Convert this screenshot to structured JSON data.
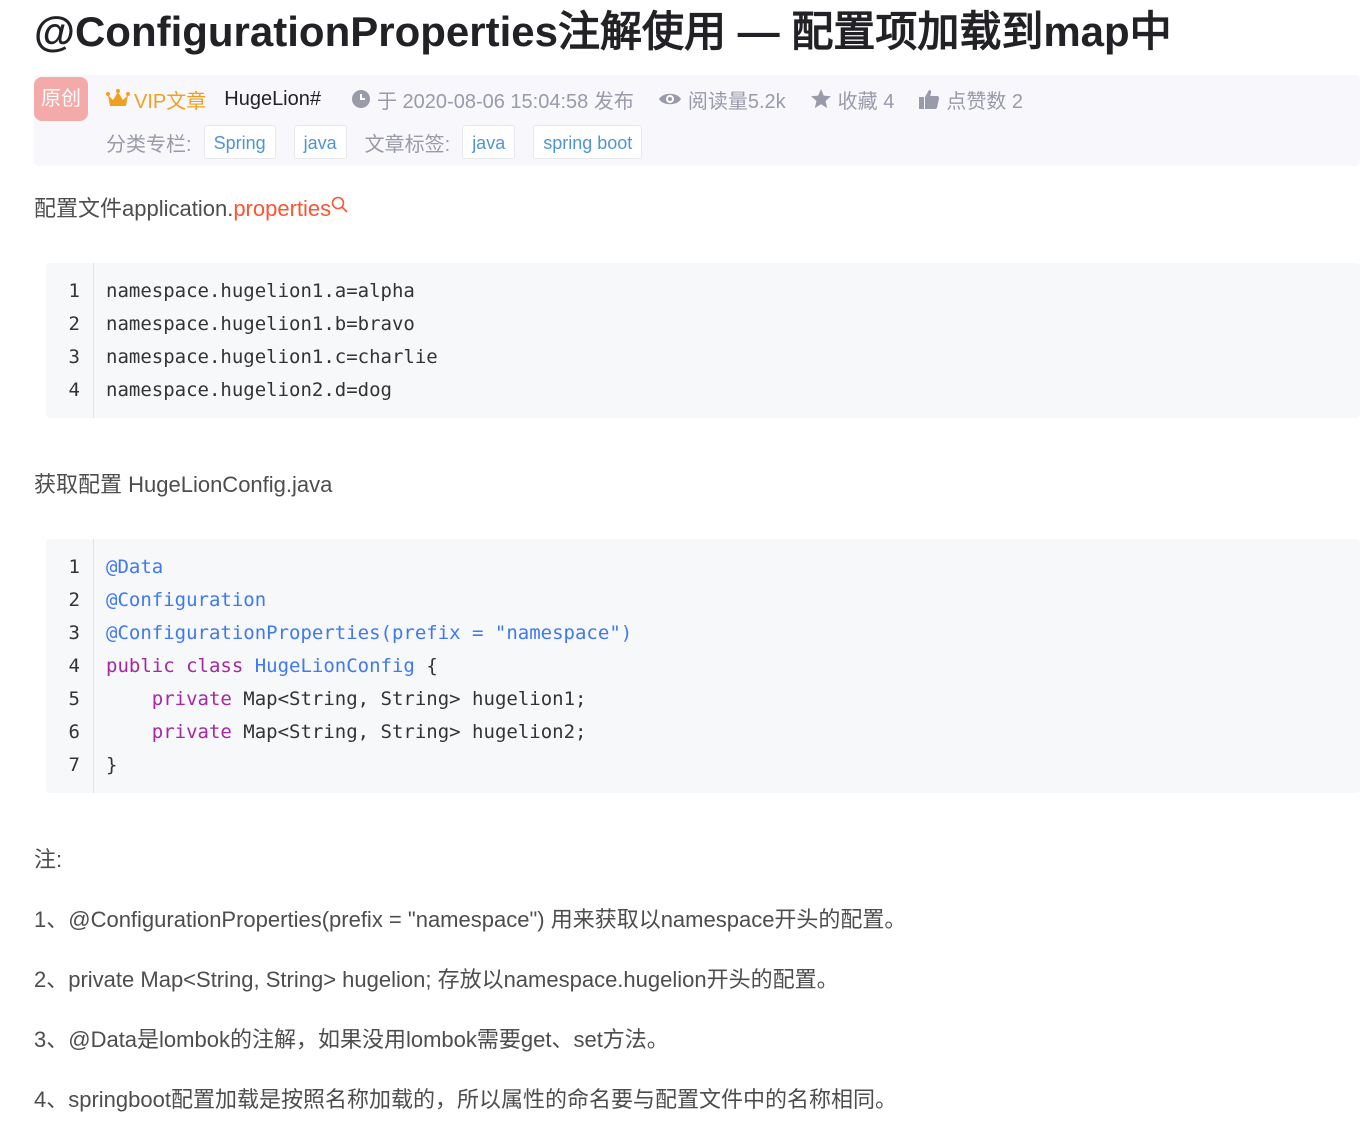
{
  "title": "@ConfigurationProperties注解使用 — 配置项加载到map中",
  "meta": {
    "badge": "原创",
    "vip_label": "VIP文章",
    "author": "HugeLion#",
    "published": "于 2020-08-06 15:04:58 发布",
    "reads": "阅读量5.2k",
    "favorites": "收藏 4",
    "likes": "点赞数 2",
    "category_label": "分类专栏:",
    "categories": [
      "Spring",
      "java"
    ],
    "tag_label": "文章标签:",
    "tags": [
      "java",
      "spring boot"
    ]
  },
  "p1": {
    "text": "配置文件application.",
    "link": "properties"
  },
  "code1": {
    "line_numbers": [
      "1",
      "2",
      "3",
      "4"
    ],
    "lines": [
      "namespace.hugelion1.a=alpha",
      "namespace.hugelion1.b=bravo",
      "namespace.hugelion1.c=charlie",
      "namespace.hugelion2.d=dog"
    ]
  },
  "p2": "获取配置 HugeLionConfig.java",
  "code2": {
    "line_numbers": [
      "1",
      "2",
      "3",
      "4",
      "5",
      "6",
      "7"
    ],
    "l1": "@Data",
    "l2": "@Configuration",
    "l3": "@ConfigurationProperties(prefix = \"namespace\")",
    "l4_kw": "public class ",
    "l4_cls": "HugeLionConfig",
    "l4_rest": " {",
    "l5_indent": "    ",
    "l5_kw": "private",
    "l5_rest": " Map<String, String> hugelion1;",
    "l6_indent": "    ",
    "l6_kw": "private",
    "l6_rest": " Map<String, String> hugelion2;",
    "l7": "}"
  },
  "notes": {
    "heading": "注:",
    "items": [
      "1、@ConfigurationProperties(prefix = \"namespace\") 用来获取以namespace开头的配置。",
      "2、private Map<String, String> hugelion; 存放以namespace.hugelion开头的配置。",
      "3、@Data是lombok的注解，如果没用lombok需要get、set方法。",
      "4、springboot配置加载是按照名称加载的，所以属性的命名要与配置文件中的名称相同。"
    ]
  },
  "colors": {
    "link": "#fc5531",
    "tag_text": "#5094d5",
    "vip": "#f0a020",
    "badge_bg": "#f3aaa9"
  },
  "icons": [
    "crown-icon",
    "clock-icon",
    "eye-icon",
    "star-icon",
    "thumbs-up-icon",
    "search-icon"
  ]
}
